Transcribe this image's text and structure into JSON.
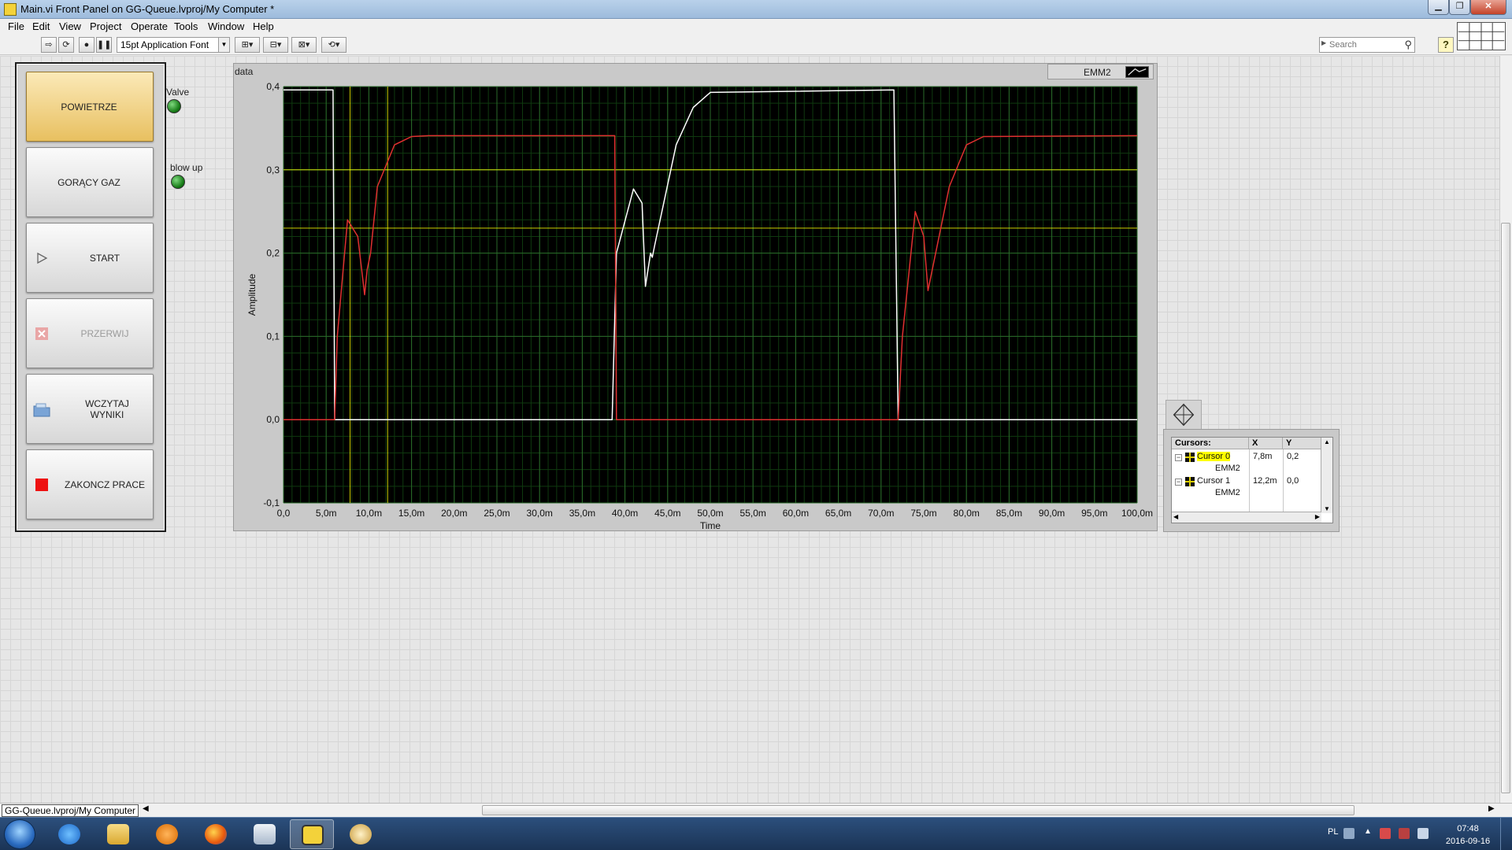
{
  "window": {
    "title": "Main.vi Front Panel on GG-Queue.lvproj/My Computer *"
  },
  "menu": [
    "File",
    "Edit",
    "View",
    "Project",
    "Operate",
    "Tools",
    "Window",
    "Help"
  ],
  "toolbar": {
    "font": "15pt Application Font",
    "search_placeholder": "Search"
  },
  "buttons": [
    {
      "label": "POWIETRZE",
      "state": "active"
    },
    {
      "label": "GORĄCY GAZ",
      "state": "normal"
    },
    {
      "label": "START",
      "state": "normal",
      "icon": "play-icon"
    },
    {
      "label": "PRZERWIJ",
      "state": "disabled",
      "icon": "cancel-icon"
    },
    {
      "label": "WCZYTAJ WYNIKI",
      "state": "normal",
      "icon": "folder-icon"
    },
    {
      "label": "ZAKONCZ PRACE",
      "state": "normal",
      "icon": "stop-icon"
    }
  ],
  "indicators": [
    {
      "label": "Valve",
      "color": "#1a8a1a"
    },
    {
      "label": "blow up",
      "color": "#1a8a1a"
    }
  ],
  "graph": {
    "title": "data",
    "legend": "EMM2",
    "xlabel": "Time",
    "ylabel": "Amplitude",
    "x_ticks": [
      "0,0",
      "5,0m",
      "10,0m",
      "15,0m",
      "20,0m",
      "25,0m",
      "30,0m",
      "35,0m",
      "40,0m",
      "45,0m",
      "50,0m",
      "55,0m",
      "60,0m",
      "65,0m",
      "70,0m",
      "75,0m",
      "80,0m",
      "85,0m",
      "90,0m",
      "95,0m",
      "100,0m"
    ],
    "y_ticks": [
      "0,4",
      "0,3",
      "0,2",
      "0,1",
      "0,0",
      "-0,1"
    ]
  },
  "chart_data": {
    "type": "line",
    "xlabel": "Time",
    "ylabel": "Amplitude",
    "xlim": [
      0,
      0.1
    ],
    "ylim": [
      -0.1,
      0.4
    ],
    "grid": true,
    "series": [
      {
        "color": "#ffffff",
        "x": [
          0,
          0.0058,
          0.006,
          0.0385,
          0.039,
          0.041,
          0.042,
          0.0424,
          0.043,
          0.0432,
          0.0435,
          0.046,
          0.048,
          0.05,
          0.0715,
          0.072,
          0.1
        ],
        "y": [
          0.396,
          0.396,
          0.0,
          0.0,
          0.2,
          0.277,
          0.26,
          0.16,
          0.2,
          0.195,
          0.21,
          0.33,
          0.375,
          0.393,
          0.396,
          0.0,
          0.0
        ]
      },
      {
        "color": "#e03030",
        "x": [
          0,
          0.006,
          0.0063,
          0.0075,
          0.0087,
          0.0095,
          0.0098,
          0.0102,
          0.011,
          0.013,
          0.015,
          0.017,
          0.0388,
          0.039,
          0.072,
          0.0725,
          0.074,
          0.075,
          0.0755,
          0.076,
          0.078,
          0.08,
          0.082,
          0.1
        ],
        "y": [
          0.0,
          0.0,
          0.1,
          0.24,
          0.22,
          0.15,
          0.18,
          0.2,
          0.28,
          0.33,
          0.34,
          0.341,
          0.341,
          0.0,
          0.0,
          0.1,
          0.25,
          0.22,
          0.155,
          0.18,
          0.28,
          0.33,
          0.34,
          0.341
        ]
      }
    ],
    "cursors": [
      {
        "name": "Cursor 0",
        "plot": "EMM2",
        "x": "7,8m",
        "y": "0,2",
        "x_value": 0.0078,
        "y_value": 0.23,
        "color": "#ffff00"
      },
      {
        "name": "Cursor 1",
        "plot": "EMM2",
        "x": "12,2m",
        "y": "0,0",
        "x_value": 0.0122,
        "y_value": 0.3,
        "color": "#ffff00"
      }
    ]
  },
  "cursor_table": {
    "headers": [
      "Cursors:",
      "X",
      "Y"
    ]
  },
  "status": {
    "project": "GG-Queue.lvproj/My Computer"
  },
  "taskbar": {
    "lang": "PL",
    "time": "07:48",
    "date": "2016-09-16"
  }
}
